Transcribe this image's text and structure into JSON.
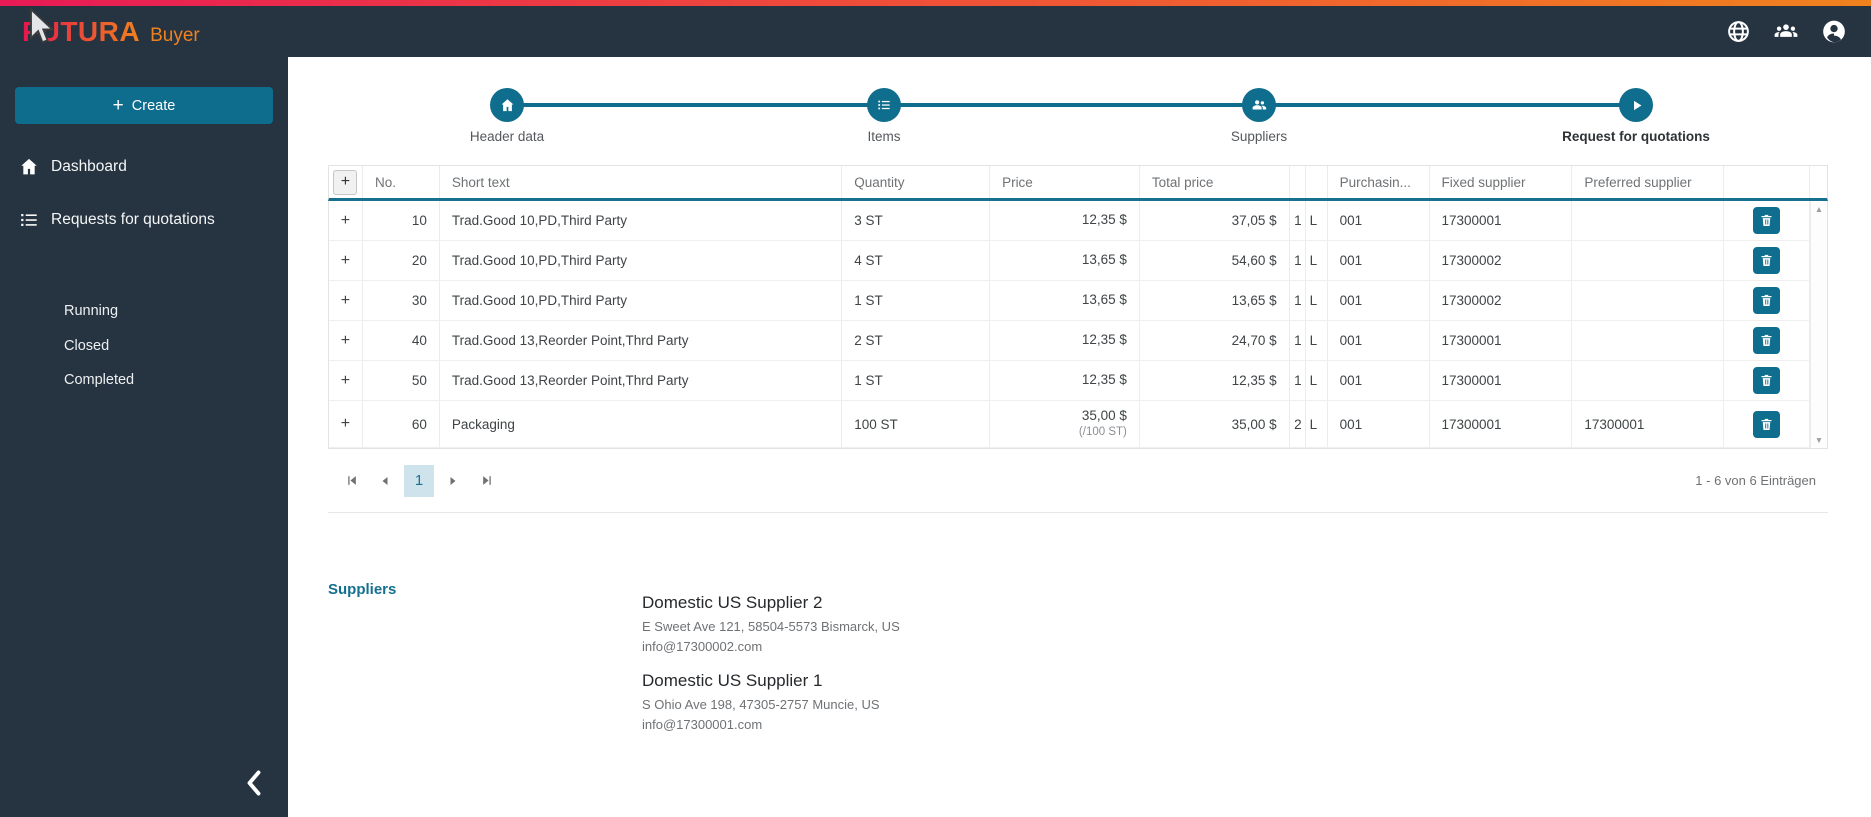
{
  "brand": {
    "name": "FUTURA",
    "product": "Buyer"
  },
  "topbar": {
    "icons": [
      "globe",
      "people-group",
      "account"
    ]
  },
  "sidebar": {
    "create_button": "Create",
    "items": [
      {
        "icon": "home",
        "label": "Dashboard"
      },
      {
        "icon": "list",
        "label": "Requests for quotations"
      }
    ],
    "sub_items": [
      "Running",
      "Closed",
      "Completed"
    ]
  },
  "stepper": [
    {
      "icon": "home",
      "label": "Header data"
    },
    {
      "icon": "list",
      "label": "Items"
    },
    {
      "icon": "people",
      "label": "Suppliers"
    },
    {
      "icon": "play",
      "label": "Request for quotations",
      "active": true
    }
  ],
  "table": {
    "add_button_label": "+",
    "expand_glyph": "+",
    "headers": {
      "no": "No.",
      "short_text": "Short text",
      "quantity": "Quantity",
      "price": "Price",
      "total_price": "Total price",
      "purchasing": "Purchasin...",
      "fixed_supplier": "Fixed supplier",
      "preferred_supplier": "Preferred supplier"
    },
    "rows": [
      {
        "no": "10",
        "short_text": "Trad.Good 10,PD,Third Party",
        "quantity": "3 ST",
        "price": "12,35 $",
        "price_note": "",
        "total": "37,05 $",
        "qty2": "1",
        "unit": "L",
        "purchasing": "001",
        "fixed_supplier": "17300001",
        "preferred_supplier": ""
      },
      {
        "no": "20",
        "short_text": "Trad.Good 10,PD,Third Party",
        "quantity": "4 ST",
        "price": "13,65 $",
        "price_note": "",
        "total": "54,60 $",
        "qty2": "1",
        "unit": "L",
        "purchasing": "001",
        "fixed_supplier": "17300002",
        "preferred_supplier": ""
      },
      {
        "no": "30",
        "short_text": "Trad.Good 10,PD,Third Party",
        "quantity": "1 ST",
        "price": "13,65 $",
        "price_note": "",
        "total": "13,65 $",
        "qty2": "1",
        "unit": "L",
        "purchasing": "001",
        "fixed_supplier": "17300002",
        "preferred_supplier": ""
      },
      {
        "no": "40",
        "short_text": "Trad.Good 13,Reorder Point,Thrd Party",
        "quantity": "2 ST",
        "price": "12,35 $",
        "price_note": "",
        "total": "24,70 $",
        "qty2": "1",
        "unit": "L",
        "purchasing": "001",
        "fixed_supplier": "17300001",
        "preferred_supplier": ""
      },
      {
        "no": "50",
        "short_text": "Trad.Good 13,Reorder Point,Thrd Party",
        "quantity": "1 ST",
        "price": "12,35 $",
        "price_note": "",
        "total": "12,35 $",
        "qty2": "1",
        "unit": "L",
        "purchasing": "001",
        "fixed_supplier": "17300001",
        "preferred_supplier": ""
      },
      {
        "no": "60",
        "short_text": "Packaging",
        "quantity": "100 ST",
        "price": "35,00 $",
        "price_note": "(/100 ST)",
        "total": "35,00 $",
        "qty2": "2",
        "unit": "L",
        "purchasing": "001",
        "fixed_supplier": "17300001",
        "preferred_supplier": "17300001"
      }
    ]
  },
  "pagination": {
    "current_page": "1",
    "summary": "1 - 6 von 6 Einträgen"
  },
  "suppliers_section": {
    "title": "Suppliers",
    "suppliers": [
      {
        "name": "Domestic US Supplier 2",
        "address": "E Sweet Ave 121, 58504-5573 Bismarck, US",
        "email": "info@17300002.com"
      },
      {
        "name": "Domestic US Supplier 1",
        "address": "S Ohio Ave 198, 47305-2757 Muncie, US",
        "email": "info@17300001.com"
      }
    ]
  },
  "colors": {
    "accent_teal": "#0f6d8e",
    "brand_pink": "#e5164f",
    "brand_orange": "#f0821e",
    "sidebar_bg": "#263340",
    "page_box_bg": "#cfe3ed"
  }
}
